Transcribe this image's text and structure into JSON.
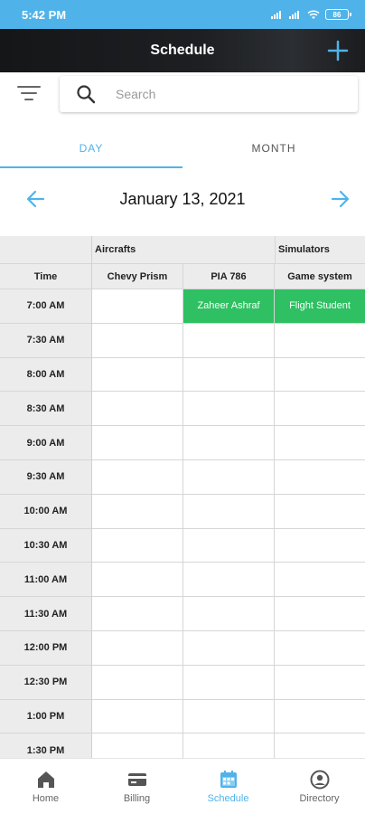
{
  "status_bar": {
    "time": "5:42 PM",
    "battery": "86"
  },
  "header": {
    "title": "Schedule",
    "add_icon": "plus-icon"
  },
  "search": {
    "placeholder": "Search",
    "value": ""
  },
  "tabs": [
    {
      "label": "DAY",
      "active": true
    },
    {
      "label": "MONTH",
      "active": false
    }
  ],
  "date_nav": {
    "date": "January 13, 2021"
  },
  "grid": {
    "groups": [
      {
        "label": "Aircrafts"
      },
      {
        "label": "Simulators"
      }
    ],
    "time_header": "Time",
    "columns": [
      "Chevy Prism",
      "PIA 786",
      "Game system"
    ],
    "slots": [
      {
        "time": "7:00 AM",
        "cells": [
          "",
          "Zaheer Ashraf",
          "Flight Student"
        ]
      },
      {
        "time": "7:30 AM",
        "cells": [
          "",
          "",
          ""
        ]
      },
      {
        "time": "8:00 AM",
        "cells": [
          "",
          "",
          ""
        ]
      },
      {
        "time": "8:30 AM",
        "cells": [
          "",
          "",
          ""
        ]
      },
      {
        "time": "9:00 AM",
        "cells": [
          "",
          "",
          ""
        ]
      },
      {
        "time": "9:30 AM",
        "cells": [
          "",
          "",
          ""
        ]
      },
      {
        "time": "10:00 AM",
        "cells": [
          "",
          "",
          ""
        ]
      },
      {
        "time": "10:30 AM",
        "cells": [
          "",
          "",
          ""
        ]
      },
      {
        "time": "11:00 AM",
        "cells": [
          "",
          "",
          ""
        ]
      },
      {
        "time": "11:30 AM",
        "cells": [
          "",
          "",
          ""
        ]
      },
      {
        "time": "12:00 PM",
        "cells": [
          "",
          "",
          ""
        ]
      },
      {
        "time": "12:30 PM",
        "cells": [
          "",
          "",
          ""
        ]
      },
      {
        "time": "1:00 PM",
        "cells": [
          "",
          "",
          ""
        ]
      },
      {
        "time": "1:30 PM",
        "cells": [
          "",
          "",
          ""
        ]
      }
    ]
  },
  "bottom_nav": [
    {
      "label": "Home",
      "icon": "home-icon",
      "active": false
    },
    {
      "label": "Billing",
      "icon": "card-icon",
      "active": false
    },
    {
      "label": "Schedule",
      "icon": "calendar-icon",
      "active": true
    },
    {
      "label": "Directory",
      "icon": "user-circle-icon",
      "active": false
    }
  ],
  "colors": {
    "accent": "#4fb3ea",
    "booked": "#2ec062",
    "header_bg": "#1d1f22",
    "grid_header_bg": "#ececec"
  }
}
